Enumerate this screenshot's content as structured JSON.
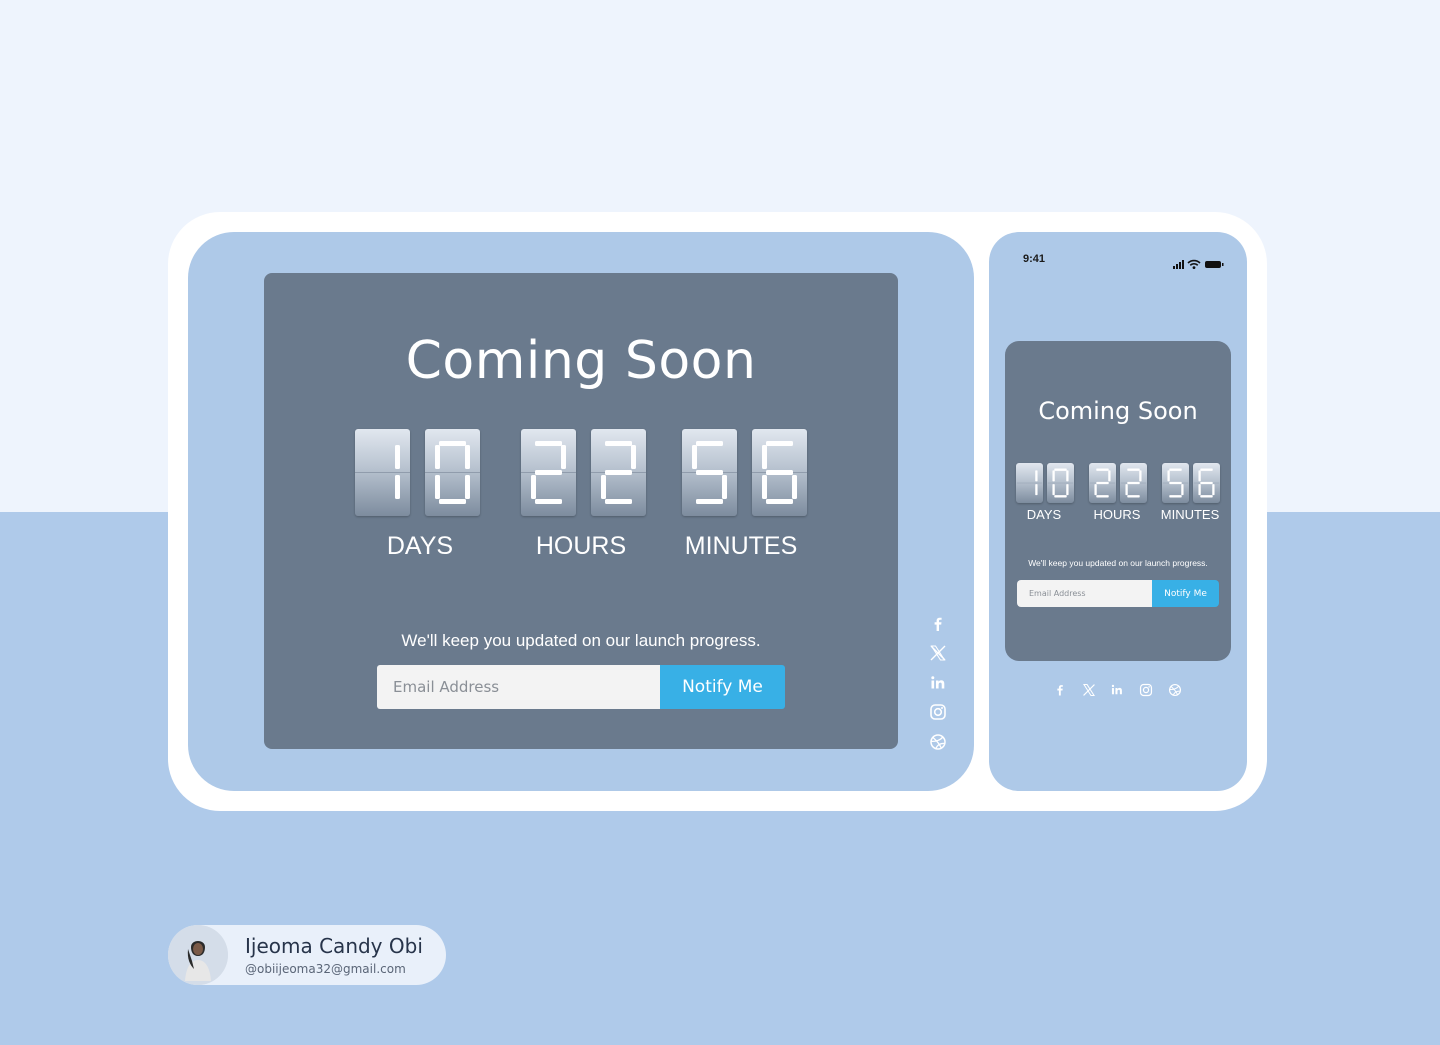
{
  "desktop": {
    "title": "Coming Soon",
    "countdown": {
      "days": [
        "1",
        "0"
      ],
      "hours": [
        "2",
        "2"
      ],
      "minutes": [
        "5",
        "6"
      ],
      "labels": {
        "days": "DAYS",
        "hours": "HOURS",
        "minutes": "MINUTES"
      }
    },
    "note": "We'll keep you updated on our launch progress.",
    "email_placeholder": "Email Address",
    "notify_label": "Notify Me",
    "social_icons": [
      "facebook-icon",
      "x-icon",
      "linkedin-icon",
      "instagram-icon",
      "dribbble-icon"
    ]
  },
  "mobile": {
    "status_time": "9:41",
    "title": "Coming Soon",
    "countdown": {
      "days": [
        "1",
        "0"
      ],
      "hours": [
        "2",
        "2"
      ],
      "minutes": [
        "5",
        "6"
      ],
      "labels": {
        "days": "DAYS",
        "hours": "HOURS",
        "minutes": "MINUTES"
      }
    },
    "note": "We'll keep you updated on our launch progress.",
    "email_placeholder": "Email Address",
    "notify_label": "Notify Me",
    "social_icons": [
      "facebook-icon",
      "x-icon",
      "linkedin-icon",
      "instagram-icon",
      "dribbble-icon"
    ]
  },
  "author": {
    "name": "Ijeoma Candy Obi",
    "email": "@obiijeoma32@gmail.com"
  },
  "colors": {
    "accent": "#38b0e6",
    "card": "#6a7a8d",
    "panel": "#aec9e8",
    "page_top": "#eef4fd",
    "page_bottom": "#afcaea"
  }
}
